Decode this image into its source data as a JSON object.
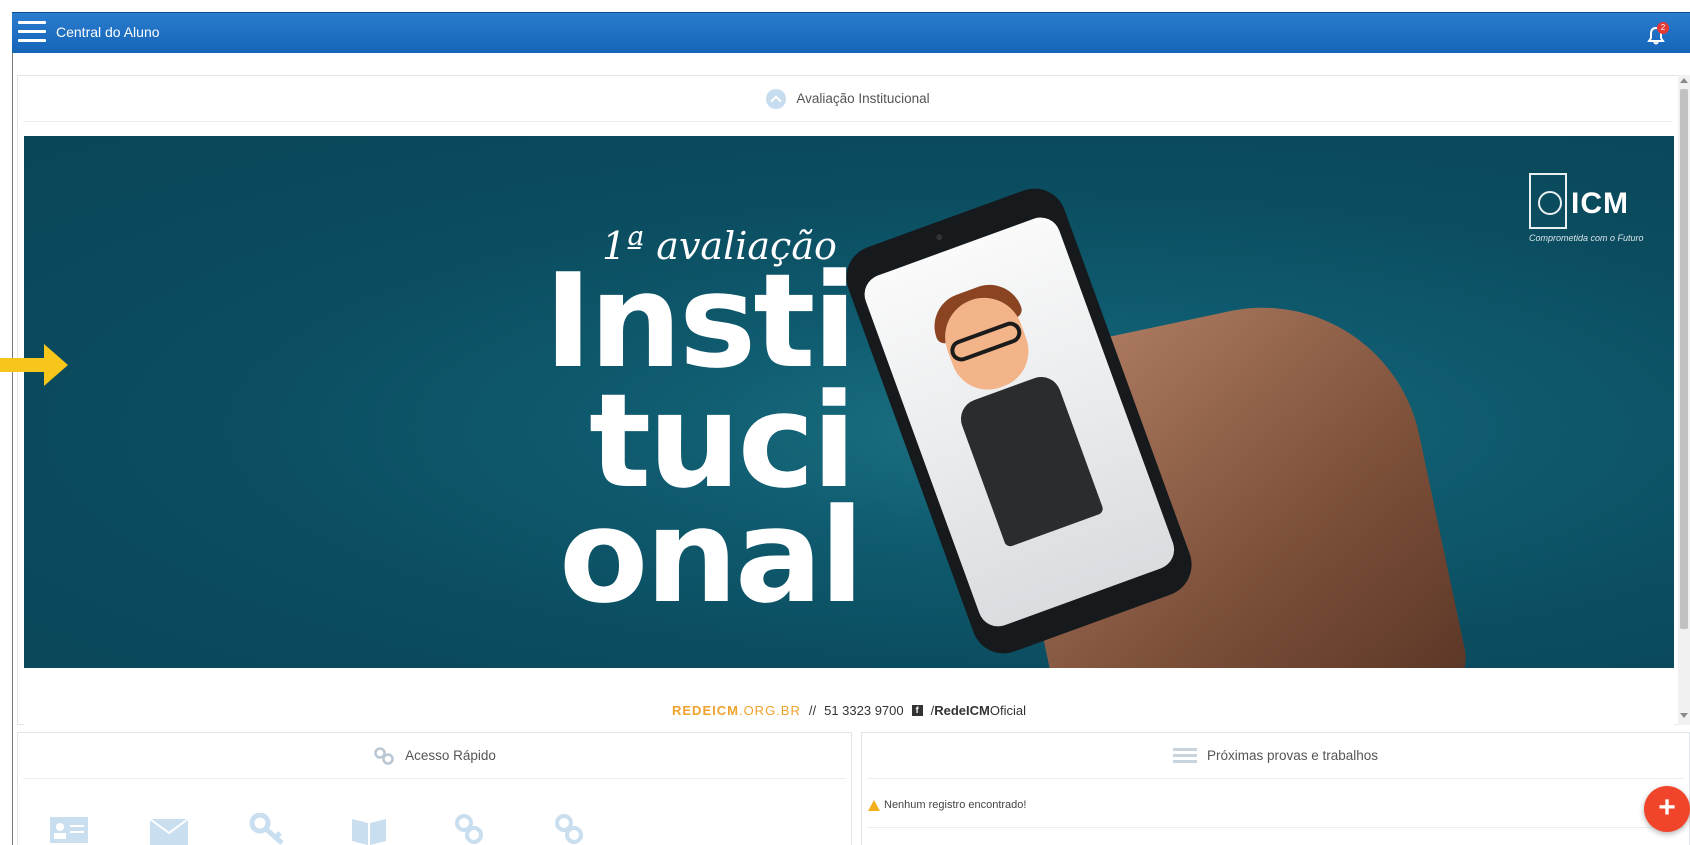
{
  "header": {
    "title": "Central do Aluno",
    "notification_count": "2",
    "menu_icon": "hamburger-icon",
    "bell_icon": "bell-icon"
  },
  "main_panel": {
    "title": "Avaliação Institucional",
    "icon": "chevron-up-icon"
  },
  "banner": {
    "line1": "1ª avaliação",
    "big1": "Insti",
    "big2": "tuci",
    "big3": "onal",
    "brand_name": "ICM",
    "brand_tagline": "Comprometida com o Futuro",
    "footer_site_bold": "REDEICM",
    "footer_site_rest": ".ORG.BR",
    "footer_sep": "//",
    "footer_phone": "51 3323 9700",
    "footer_fb": "f",
    "footer_handle_prefix": "/",
    "footer_handle_bold": "RedeICM",
    "footer_handle_rest": "Oficial"
  },
  "quick_access": {
    "title": "Acesso Rápido",
    "icon": "link-icon",
    "items": [
      {
        "icon": "id-card-icon"
      },
      {
        "icon": "envelope-icon"
      },
      {
        "icon": "key-icon"
      },
      {
        "icon": "book-icon"
      },
      {
        "icon": "link-icon"
      },
      {
        "icon": "link-icon"
      }
    ]
  },
  "upcoming": {
    "title": "Próximas provas e trabalhos",
    "icon": "list-icon",
    "empty_message": "Nenhum registro encontrado!"
  },
  "fab": {
    "label": "+"
  },
  "colors": {
    "topbar": "#1f6fc2",
    "banner_bg": "#0b4c5f",
    "accent_orange": "#f0a22e",
    "fab_red": "#f0452a",
    "arrow_yellow": "#f7c61a"
  }
}
